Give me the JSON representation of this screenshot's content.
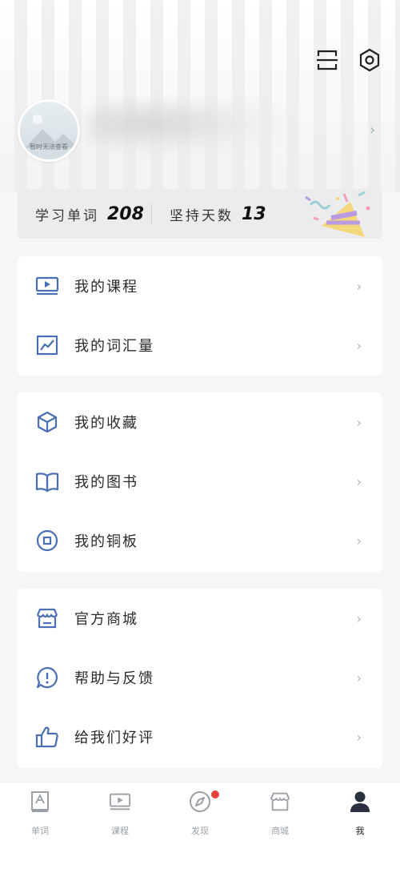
{
  "profile": {
    "avatar_caption": "暂时无法查看"
  },
  "stats": {
    "words_label": "学习单词",
    "words_value": "208",
    "days_label": "坚持天数",
    "days_value": "13"
  },
  "menu_group_1": [
    {
      "label": "我的课程",
      "icon": "video-course-icon"
    },
    {
      "label": "我的词汇量",
      "icon": "trend-chart-icon"
    }
  ],
  "menu_group_2": [
    {
      "label": "我的收藏",
      "icon": "cube-icon"
    },
    {
      "label": "我的图书",
      "icon": "open-book-icon"
    },
    {
      "label": "我的铜板",
      "icon": "coin-icon"
    }
  ],
  "menu_group_3": [
    {
      "label": "官方商城",
      "icon": "store-icon"
    },
    {
      "label": "帮助与反馈",
      "icon": "help-bubble-icon"
    },
    {
      "label": "给我们好评",
      "icon": "thumbs-up-icon"
    }
  ],
  "tabbar": [
    {
      "label": "单词",
      "icon": "word-book-icon",
      "active": false
    },
    {
      "label": "课程",
      "icon": "course-video-icon",
      "active": false
    },
    {
      "label": "发现",
      "icon": "compass-icon",
      "active": false,
      "badge": true
    },
    {
      "label": "商城",
      "icon": "shop-icon",
      "active": false
    },
    {
      "label": "我",
      "icon": "person-icon",
      "active": true
    }
  ],
  "colors": {
    "accent_icon": "#4a6fb4",
    "badge": "#e8413c",
    "stats_bg": "#ececee"
  }
}
